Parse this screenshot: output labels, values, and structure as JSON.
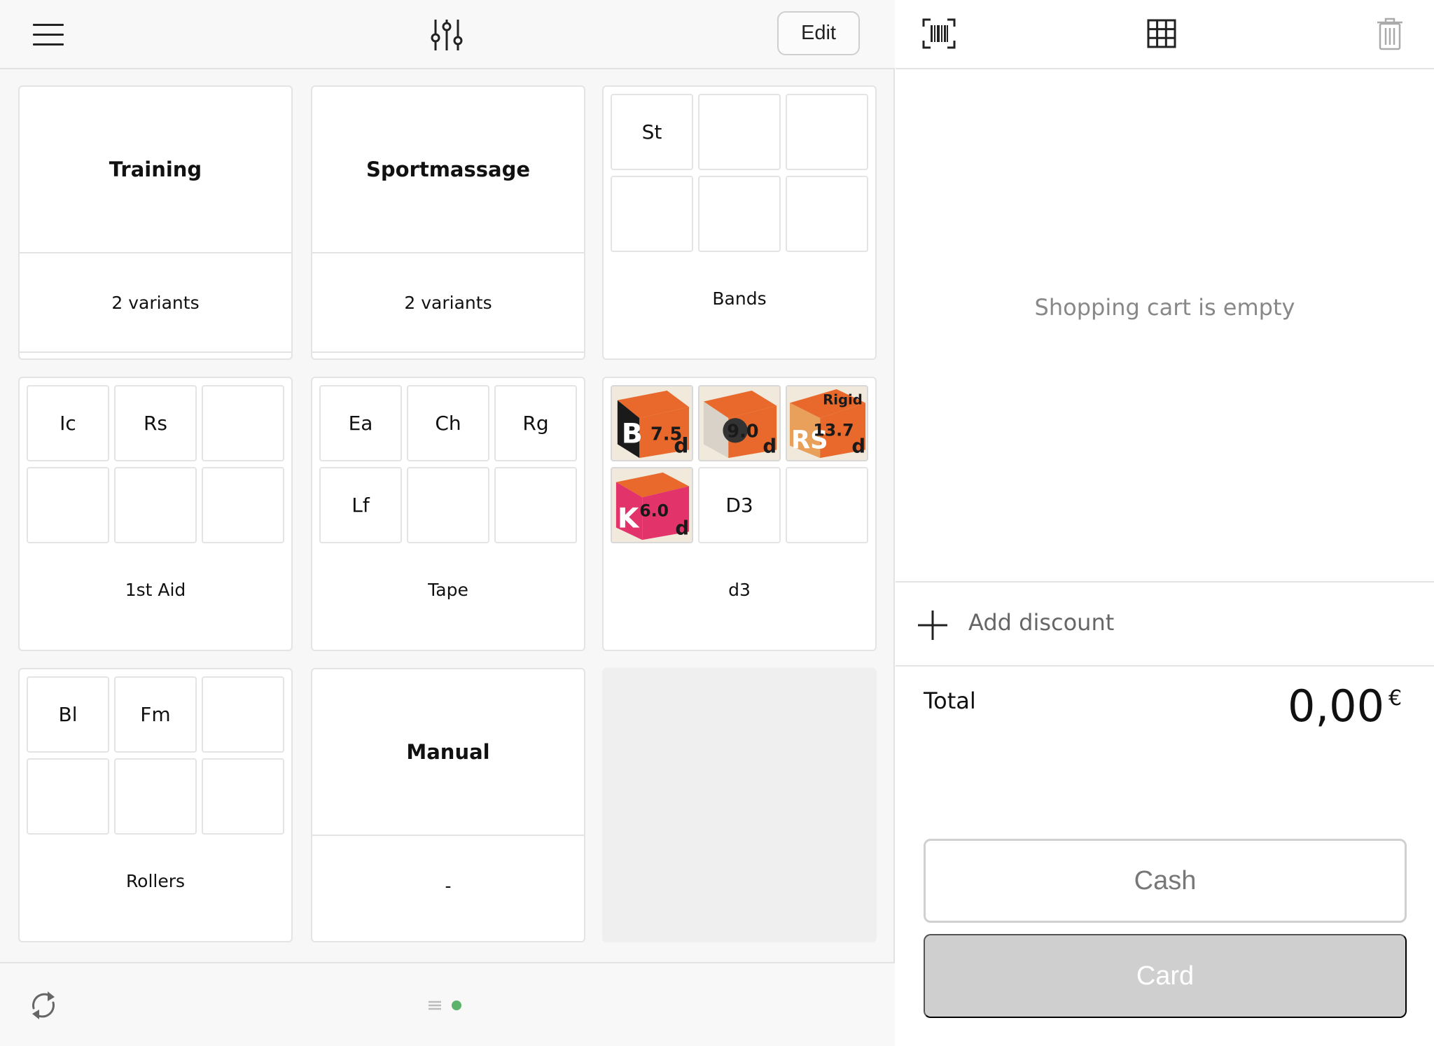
{
  "toolbar": {
    "menu_icon": "hamburger-menu-icon",
    "filter_icon": "sliders-icon",
    "edit_label": "Edit"
  },
  "tiles": [
    {
      "kind": "product",
      "name": "Training",
      "subtitle": "2 variants"
    },
    {
      "kind": "product",
      "name": "Sportmassage",
      "subtitle": "2 variants"
    },
    {
      "kind": "folder",
      "label": "Bands",
      "cells": [
        "St",
        "",
        "",
        "",
        "",
        ""
      ]
    },
    {
      "kind": "folder",
      "label": "1st Aid",
      "cells": [
        "Ic",
        "Rs",
        "",
        "",
        "",
        ""
      ]
    },
    {
      "kind": "folder",
      "label": "Tape",
      "cells": [
        "Ea",
        "Ch",
        "Rg",
        "Lf",
        "",
        ""
      ]
    },
    {
      "kind": "folder",
      "label": "d3",
      "cells": [
        "",
        "",
        "",
        "",
        "D3",
        ""
      ],
      "image_cells": [
        "d3-tape-7.5-image",
        "d3-tape-9.0-image",
        "d3-rigid-13.7-image",
        "d3-kinesiology-6.0-image"
      ]
    },
    {
      "kind": "folder",
      "label": "Rollers",
      "cells": [
        "Bl",
        "Fm",
        "",
        "",
        "",
        ""
      ]
    },
    {
      "kind": "product",
      "name": "Manual",
      "subtitle": "-"
    },
    {
      "kind": "empty"
    }
  ],
  "image_colors": {
    "orange": "#e8692b",
    "black": "#1a1a1a",
    "pink": "#e2336b",
    "cream": "#f1e9dc"
  },
  "image_texts": {
    "t1": "7.5",
    "t2": "9.0",
    "t3": "13.7",
    "t3_brand": "Rigid",
    "t4": "6.0"
  },
  "bottom": {
    "refresh_icon": "refresh-icon",
    "page_list_icon": "list-icon",
    "active_dot_color": "#5db36b"
  },
  "cart": {
    "barcode_icon": "barcode-scan-icon",
    "grid_icon": "grid-icon",
    "trash_icon": "trash-icon",
    "empty_text": "Shopping cart is empty",
    "discount_label": "Add discount",
    "total_label": "Total",
    "total_amount": "0,00",
    "currency": "€",
    "cash_label": "Cash",
    "card_label": "Card"
  }
}
